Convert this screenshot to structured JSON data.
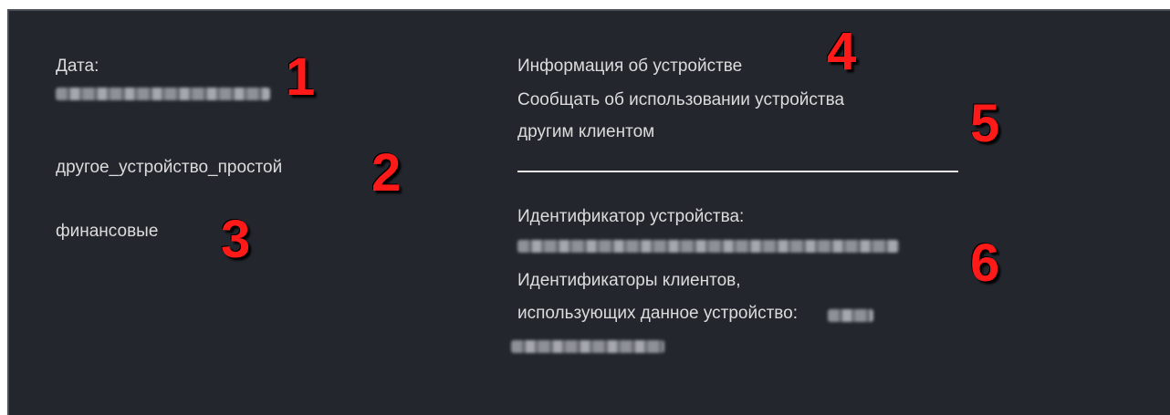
{
  "left": {
    "date_label": "Дата:",
    "device_type": "другое_устройство_простой",
    "category": "финансовые"
  },
  "right": {
    "device_info_label": "Информация об устройстве",
    "report_line1": "Сообщать об использовании устройства",
    "report_line2": "другим клиентом",
    "device_id_label": "Идентификатор устройства:",
    "client_ids_line1": "Идентификаторы клиентов,",
    "client_ids_line2": "использующих данное устройство:"
  },
  "markers": [
    "1",
    "2",
    "3",
    "4",
    "5",
    "6"
  ],
  "colors": {
    "panel_bg": "#23262d",
    "text": "#dcdcdc",
    "marker": "#ff1a1a"
  }
}
